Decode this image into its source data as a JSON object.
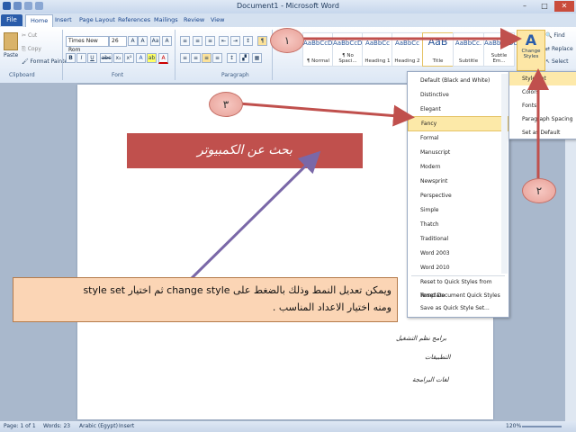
{
  "window": {
    "title": "Document1 - Microsoft Word"
  },
  "tabs": [
    "File",
    "Home",
    "Insert",
    "Page Layout",
    "References",
    "Mailings",
    "Review",
    "View"
  ],
  "clipboard": {
    "paste": "Paste",
    "cut": "Cut",
    "copy": "Copy",
    "format_painter": "Format Painter",
    "label": "Clipboard"
  },
  "font": {
    "name": "Times New Rom",
    "size": "26",
    "label": "Font",
    "buttons": [
      "B",
      "I",
      "U",
      "abc",
      "x₂",
      "x²",
      "A",
      "ab",
      "A"
    ]
  },
  "paragraph": {
    "label": "Paragraph"
  },
  "styles": {
    "tiles": [
      {
        "sample": "AaBbCcDc",
        "name": "¶ Normal"
      },
      {
        "sample": "AaBbCcDc",
        "name": "¶ No Spaci..."
      },
      {
        "sample": "AaBbCc",
        "name": "Heading 1"
      },
      {
        "sample": "AaBbCc",
        "name": "Heading 2"
      },
      {
        "sample": "AaB",
        "name": "Title"
      },
      {
        "sample": "AaBbCc.",
        "name": "Subtitle"
      },
      {
        "sample": "AaBbCcDc",
        "name": "Subtle Em..."
      }
    ],
    "change_styles": "Change Styles"
  },
  "editing": {
    "find": "Find",
    "replace": "Replace",
    "select": "Select"
  },
  "change_styles_menu": [
    "Style Set",
    "Colors",
    "Fonts",
    "Paragraph Spacing",
    "Set as Default"
  ],
  "style_set_menu": {
    "items": [
      "Default (Black and White)",
      "Distinctive",
      "Elegant",
      "Fancy",
      "Formal",
      "Manuscript",
      "Modern",
      "Newsprint",
      "Perspective",
      "Simple",
      "Thatch",
      "Traditional",
      "Word 2003",
      "Word 2010"
    ],
    "highlighted": "Fancy",
    "footer": [
      "Reset to Quick Styles from Template",
      "Reset Document Quick Styles",
      "Save as Quick Style Set..."
    ]
  },
  "document": {
    "banner": "بحث عن الكمبيوتر",
    "lines": [
      "برامج نظم التشغيل",
      "التطبيقات",
      "لغات البرامجة"
    ]
  },
  "callouts": [
    "١",
    "٣",
    "٢"
  ],
  "note": {
    "line1": "ويمكن تعديل النمط وذلك بالضغط على change style ثم اختيار style set",
    "line2": "ومنه اختيار الاعداد المناسب ."
  },
  "status": {
    "page": "Page: 1 of 1",
    "words": "Words: 23",
    "language": "Arabic (Egypt)",
    "mode": "Insert",
    "zoom": "120%"
  },
  "colors": {
    "accent": "#2a5caa",
    "banner": "#c0504d",
    "highlight": "#fce9a8",
    "note_bg": "#fbd5b5",
    "arrow_red": "#c0504d",
    "arrow_purple": "#7a68a8"
  }
}
